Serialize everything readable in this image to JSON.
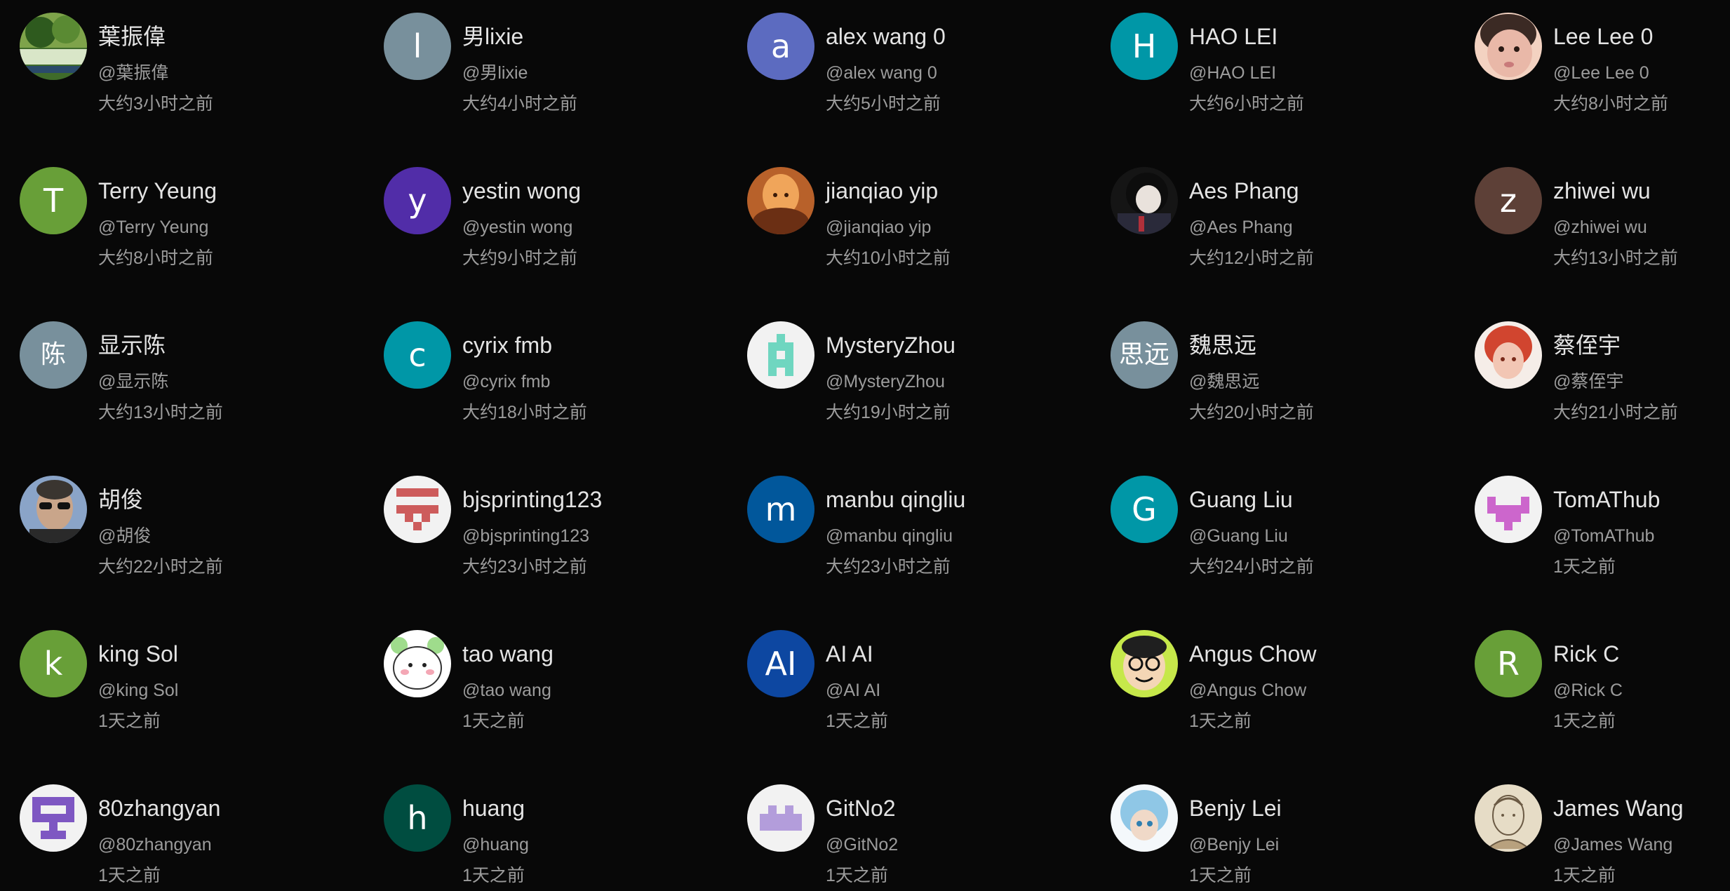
{
  "users": [
    {
      "name": "葉振偉",
      "handle": "@葉振偉",
      "time": "大约3小时之前",
      "avatar": {
        "type": "photo",
        "icon": "park-photo-avatar",
        "colors": [
          "#3f6b2a",
          "#7ea34a",
          "#d9e6c8"
        ]
      }
    },
    {
      "name": "男lixie",
      "handle": "@男lixie",
      "time": "大约4小时之前",
      "avatar": {
        "type": "letter",
        "letter": "l",
        "bg": "#78909c"
      }
    },
    {
      "name": "alex wang 0",
      "handle": "@alex wang 0",
      "time": "大约5小时之前",
      "avatar": {
        "type": "letter",
        "letter": "a",
        "bg": "#5c6bc0"
      }
    },
    {
      "name": "HAO LEI",
      "handle": "@HAO LEI",
      "time": "大约6小时之前",
      "avatar": {
        "type": "letter",
        "letter": "H",
        "bg": "#0097a7"
      }
    },
    {
      "name": "Lee Lee 0",
      "handle": "@Lee Lee 0",
      "time": "大约8小时之前",
      "avatar": {
        "type": "photo",
        "icon": "child-photo-avatar",
        "colors": [
          "#f3d2c1",
          "#3b2a24",
          "#e9b8a8"
        ]
      }
    },
    {
      "name": "Terry Yeung",
      "handle": "@Terry Yeung",
      "time": "大约8小时之前",
      "avatar": {
        "type": "letter",
        "letter": "T",
        "bg": "#689f38"
      }
    },
    {
      "name": "yestin wong",
      "handle": "@yestin wong",
      "time": "大约9小时之前",
      "avatar": {
        "type": "letter",
        "letter": "y",
        "bg": "#512da8"
      }
    },
    {
      "name": "jianqiao yip",
      "handle": "@jianqiao yip",
      "time": "大约10小时之前",
      "avatar": {
        "type": "photo",
        "icon": "warm-art-avatar",
        "colors": [
          "#b8612a",
          "#f0a55a",
          "#6b2f14"
        ]
      }
    },
    {
      "name": "Aes Phang",
      "handle": "@Aes Phang",
      "time": "大约12小时之前",
      "avatar": {
        "type": "photo",
        "icon": "anime-dark-avatar",
        "colors": [
          "#151515",
          "#b0303a",
          "#e9e2dc"
        ]
      }
    },
    {
      "name": "zhiwei wu",
      "handle": "@zhiwei wu",
      "time": "大约13小时之前",
      "avatar": {
        "type": "letter",
        "letter": "z",
        "bg": "#5d4037"
      }
    },
    {
      "name": "显示陈",
      "handle": "@显示陈",
      "time": "大约13小时之前",
      "avatar": {
        "type": "letter",
        "letter": "陈",
        "bg": "#78909c",
        "cjk": true
      }
    },
    {
      "name": "cyrix fmb",
      "handle": "@cyrix fmb",
      "time": "大约18小时之前",
      "avatar": {
        "type": "letter",
        "letter": "c",
        "bg": "#0097a7"
      }
    },
    {
      "name": "MysteryZhou",
      "handle": "@MysteryZhou",
      "time": "大约19小时之前",
      "avatar": {
        "type": "identicon",
        "icon": "identicon-avatar",
        "fg": "#6fd6c0",
        "bg": "#f2f2f2",
        "pattern": [
          "00100",
          "01110",
          "01010",
          "01110",
          "01010"
        ]
      }
    },
    {
      "name": "魏思远",
      "handle": "@魏思远",
      "time": "大约20小时之前",
      "avatar": {
        "type": "letter",
        "letter": "思远",
        "bg": "#78909c",
        "cjk": true
      }
    },
    {
      "name": "蔡侄宇",
      "handle": "@蔡侄宇",
      "time": "大约21小时之前",
      "avatar": {
        "type": "photo",
        "icon": "anime-redhair-avatar",
        "colors": [
          "#f5ede8",
          "#d1452f",
          "#f2c6b4"
        ]
      }
    },
    {
      "name": "胡俊",
      "handle": "@胡俊",
      "time": "大约22小时之前",
      "avatar": {
        "type": "photo",
        "icon": "man-sunglasses-avatar",
        "colors": [
          "#8aa4c8",
          "#3a3530",
          "#c9a58a"
        ]
      }
    },
    {
      "name": "bjsprinting123",
      "handle": "@bjsprinting123",
      "time": "大约23小时之前",
      "avatar": {
        "type": "identicon",
        "icon": "identicon-avatar",
        "fg": "#cd5c5c",
        "bg": "#f2f2f2",
        "pattern": [
          "11111",
          "00000",
          "11111",
          "01010",
          "00100"
        ]
      }
    },
    {
      "name": "manbu qingliu",
      "handle": "@manbu qingliu",
      "time": "大约23小时之前",
      "avatar": {
        "type": "letter",
        "letter": "m",
        "bg": "#01579b"
      }
    },
    {
      "name": "Guang Liu",
      "handle": "@Guang Liu",
      "time": "大约24小时之前",
      "avatar": {
        "type": "letter",
        "letter": "G",
        "bg": "#0097a7"
      }
    },
    {
      "name": "TomAThub",
      "handle": "@TomAThub",
      "time": "1天之前",
      "avatar": {
        "type": "identicon",
        "icon": "identicon-avatar",
        "fg": "#cc66cc",
        "bg": "#f2f2f2",
        "pattern": [
          "00000",
          "10001",
          "11111",
          "01110",
          "00100"
        ]
      }
    },
    {
      "name": "king Sol",
      "handle": "@king Sol",
      "time": "1天之前",
      "avatar": {
        "type": "letter",
        "letter": "k",
        "bg": "#689f38"
      }
    },
    {
      "name": "tao wang",
      "handle": "@tao wang",
      "time": "1天之前",
      "avatar": {
        "type": "photo",
        "icon": "bear-cartoon-avatar",
        "colors": [
          "#ffffff",
          "#9fdc8c",
          "#f4a7b5"
        ]
      }
    },
    {
      "name": "AI AI",
      "handle": "@AI AI",
      "time": "1天之前",
      "avatar": {
        "type": "letter",
        "letter": "AI",
        "bg": "#0d47a1"
      }
    },
    {
      "name": "Angus Chow",
      "handle": "@Angus Chow",
      "time": "1天之前",
      "avatar": {
        "type": "photo",
        "icon": "cartoon-glasses-avatar",
        "colors": [
          "#c6e84a",
          "#1f1f1f",
          "#f4d6b5"
        ]
      }
    },
    {
      "name": "Rick C",
      "handle": "@Rick C",
      "time": "1天之前",
      "avatar": {
        "type": "letter",
        "letter": "R",
        "bg": "#689f38"
      }
    },
    {
      "name": "80zhangyan",
      "handle": "@80zhangyan",
      "time": "1天之前",
      "avatar": {
        "type": "identicon",
        "icon": "identicon-avatar",
        "fg": "#7e57c2",
        "bg": "#f2f2f2",
        "pattern": [
          "11111",
          "10001",
          "11111",
          "00100",
          "01110"
        ]
      }
    },
    {
      "name": "huang",
      "handle": "@huang",
      "time": "1天之前",
      "avatar": {
        "type": "letter",
        "letter": "h",
        "bg": "#004d40"
      }
    },
    {
      "name": "GitNo2",
      "handle": "@GitNo2",
      "time": "1天之前",
      "avatar": {
        "type": "identicon",
        "icon": "identicon-avatar",
        "fg": "#b39ddb",
        "bg": "#f2f2f2",
        "pattern": [
          "00000",
          "01010",
          "11111",
          "11111",
          "00000"
        ]
      }
    },
    {
      "name": "Benjy Lei",
      "handle": "@Benjy Lei",
      "time": "1天之前",
      "avatar": {
        "type": "photo",
        "icon": "anime-bluehair-avatar",
        "colors": [
          "#f4f8fb",
          "#8fc7e6",
          "#f0d9c8"
        ]
      }
    },
    {
      "name": "James Wang",
      "handle": "@James Wang",
      "time": "1天之前",
      "avatar": {
        "type": "photo",
        "icon": "sketch-portrait-avatar",
        "colors": [
          "#e6dcc6",
          "#6b5a44",
          "#b8a17e"
        ]
      }
    }
  ]
}
